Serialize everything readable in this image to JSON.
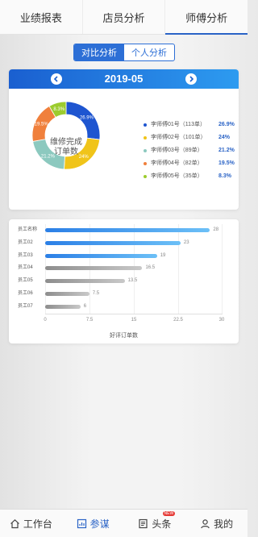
{
  "top_tabs": [
    {
      "label": "业绩报表",
      "active": false
    },
    {
      "label": "店员分析",
      "active": false
    },
    {
      "label": "师傅分析",
      "active": true
    }
  ],
  "segmented": [
    {
      "label": "对比分析",
      "active": true
    },
    {
      "label": "个人分析",
      "active": false
    }
  ],
  "month_card": {
    "month": "2019-05",
    "center_title_line1": "维修完成",
    "center_title_line2": "订单数",
    "chart_data": {
      "type": "pie",
      "title": "维修完成订单数",
      "slices": [
        {
          "name": "李师傅01号",
          "orders": "（113单）",
          "value": 26.9,
          "pct": "26.9%",
          "color": "#1e55d0"
        },
        {
          "name": "李师傅02号",
          "orders": "（101单）",
          "value": 24,
          "pct": "24%",
          "color": "#f0c419"
        },
        {
          "name": "李师傅03号",
          "orders": "（89单）",
          "value": 21.2,
          "pct": "21.2%",
          "color": "#8cc9bf"
        },
        {
          "name": "李师傅04号",
          "orders": "（82单）",
          "value": 19.5,
          "pct": "19.5%",
          "color": "#f0803c"
        },
        {
          "name": "李师傅05号",
          "orders": "（35单）",
          "value": 8.3,
          "pct": "8.3%",
          "color": "#9ccc2e"
        }
      ]
    }
  },
  "bar_card": {
    "chart_data": {
      "type": "bar",
      "orientation": "horizontal",
      "xlabel": "好评订单数",
      "xlim": [
        0,
        30
      ],
      "ticks": [
        "0",
        "7.5",
        "15",
        "22.5",
        "30"
      ],
      "categories": [
        "员工名称",
        "员工02",
        "员工03",
        "员工04",
        "员工05",
        "员工06",
        "员工07"
      ],
      "values": [
        28,
        23,
        19,
        16.5,
        13.5,
        7.5,
        6
      ],
      "value_labels": [
        "28",
        "23",
        "19",
        "16.5",
        "13.5",
        "7.5",
        "6"
      ],
      "colors": {
        "blue": "#2f8ff0",
        "gray": "#999999"
      },
      "grid": true
    }
  },
  "bottom_nav": [
    {
      "label": "工作台",
      "icon": "home-icon",
      "active": false
    },
    {
      "label": "参谋",
      "icon": "chart-icon",
      "active": true
    },
    {
      "label": "头条",
      "icon": "news-icon",
      "active": false,
      "badge": "NEW"
    },
    {
      "label": "我的",
      "icon": "user-icon",
      "active": false
    }
  ]
}
